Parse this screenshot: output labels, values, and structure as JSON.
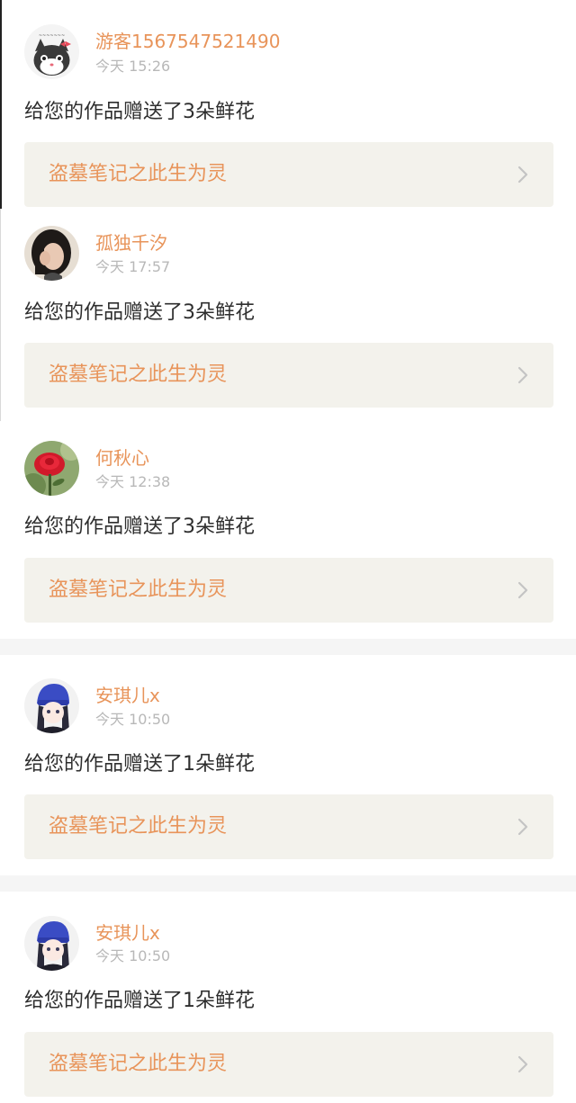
{
  "notifications": [
    {
      "username": "游客1567547521490",
      "time": "今天 15:26",
      "message": "给您的作品赠送了3朵鲜花",
      "work_title": "盗墓笔记之此生为灵",
      "avatar_icon": "cat-avatar-icon"
    },
    {
      "username": "孤独千汐",
      "time": "今天 17:57",
      "message": "给您的作品赠送了3朵鲜花",
      "work_title": "盗墓笔记之此生为灵",
      "avatar_icon": "girl-photo-avatar-icon"
    },
    {
      "username": "何秋心",
      "time": "今天 12:38",
      "message": "给您的作品赠送了3朵鲜花",
      "work_title": "盗墓笔记之此生为灵",
      "avatar_icon": "rose-avatar-icon"
    },
    {
      "username": "安琪儿x",
      "time": "今天 10:50",
      "message": "给您的作品赠送了1朵鲜花",
      "work_title": "盗墓笔记之此生为灵",
      "avatar_icon": "anime-girl-avatar-icon"
    },
    {
      "username": "安琪儿x",
      "time": "今天 10:50",
      "message": "给您的作品赠送了1朵鲜花",
      "work_title": "盗墓笔记之此生为灵",
      "avatar_icon": "anime-girl-avatar-icon"
    }
  ],
  "colors": {
    "accent": "#e8945a",
    "card_bg": "#f3f2ec",
    "text": "#2e2e2e",
    "muted": "#b8b8b8"
  }
}
